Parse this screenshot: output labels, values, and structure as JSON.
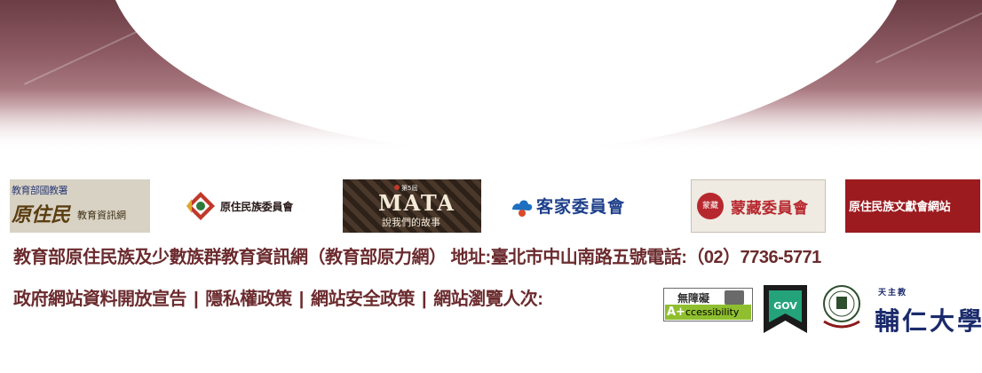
{
  "logos": [
    {
      "name": "moe-indigenous-edu-net",
      "top_text": "教育部國教署",
      "main_text": "原住民",
      "sub_text": "教育資訊網"
    },
    {
      "name": "council-indigenous-peoples",
      "text": "原住民族委員會"
    },
    {
      "name": "mata-story",
      "episode_text": "第5屆",
      "title_text": "MATA",
      "subtitle_text": "說我們的故事"
    },
    {
      "name": "hakka-affairs-council",
      "text": "客家委員會"
    },
    {
      "name": "mongolian-tibetan-commission",
      "seal_text": "蒙藏",
      "text": "蒙藏委員會"
    },
    {
      "name": "indigenous-literature-site",
      "text": "原住民族文獻會網站"
    }
  ],
  "footer": {
    "address_line": "教育部原住民族及少數族群教育資訊網（教育部原力網） 地址:臺北市中山南路五號電話:（02）7736-5771",
    "links": [
      {
        "label": "政府網站資料開放宣告"
      },
      {
        "label": "隱私權政策"
      },
      {
        "label": "網站安全政策"
      },
      {
        "label": "網站瀏覽人次:"
      }
    ],
    "separator": "|"
  },
  "badges": {
    "accessibility": {
      "title": "無障礙",
      "mark": "A+",
      "text": "ccessibility"
    },
    "gov": {
      "text": "GOV"
    },
    "fju": {
      "small_text": "天主教",
      "name": "輔仁大學"
    }
  },
  "colors": {
    "text": "#6b2b2e",
    "accent_red": "#9b1b1f",
    "hakka_blue": "#1d3f8a"
  }
}
